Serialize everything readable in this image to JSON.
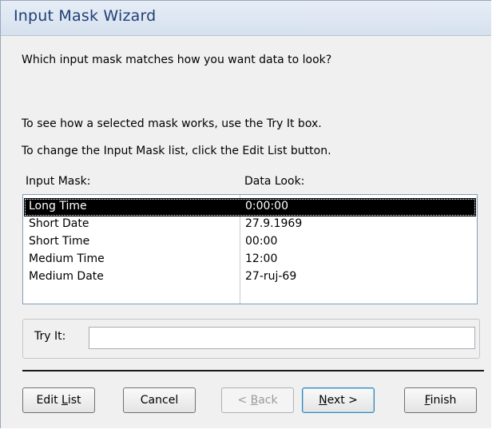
{
  "window": {
    "title": "Input Mask Wizard"
  },
  "prompt": "Which input mask matches how you want data to look?",
  "hint_try": "To see how a selected mask works, use the Try It box.",
  "hint_edit": "To change the Input Mask list, click the Edit List button.",
  "list": {
    "header_mask": "Input Mask:",
    "header_look": "Data Look:",
    "selected_index": 0,
    "rows": [
      {
        "mask": "Long Time",
        "look": "0:00:00"
      },
      {
        "mask": "Short Date",
        "look": "27.9.1969"
      },
      {
        "mask": "Short Time",
        "look": "00:00"
      },
      {
        "mask": "Medium Time",
        "look": "12:00"
      },
      {
        "mask": "Medium Date",
        "look": "27-ruj-69"
      }
    ]
  },
  "try_it": {
    "label": "Try It:",
    "value": ""
  },
  "buttons": {
    "edit_list": {
      "pre": "Edit ",
      "key": "L",
      "post": "ist"
    },
    "cancel": {
      "label": "Cancel"
    },
    "back": {
      "pre": "< ",
      "key": "B",
      "post": "ack"
    },
    "next": {
      "pre": "",
      "key": "N",
      "post": "ext >"
    },
    "finish": {
      "pre": "",
      "key": "F",
      "post": "inish"
    }
  }
}
